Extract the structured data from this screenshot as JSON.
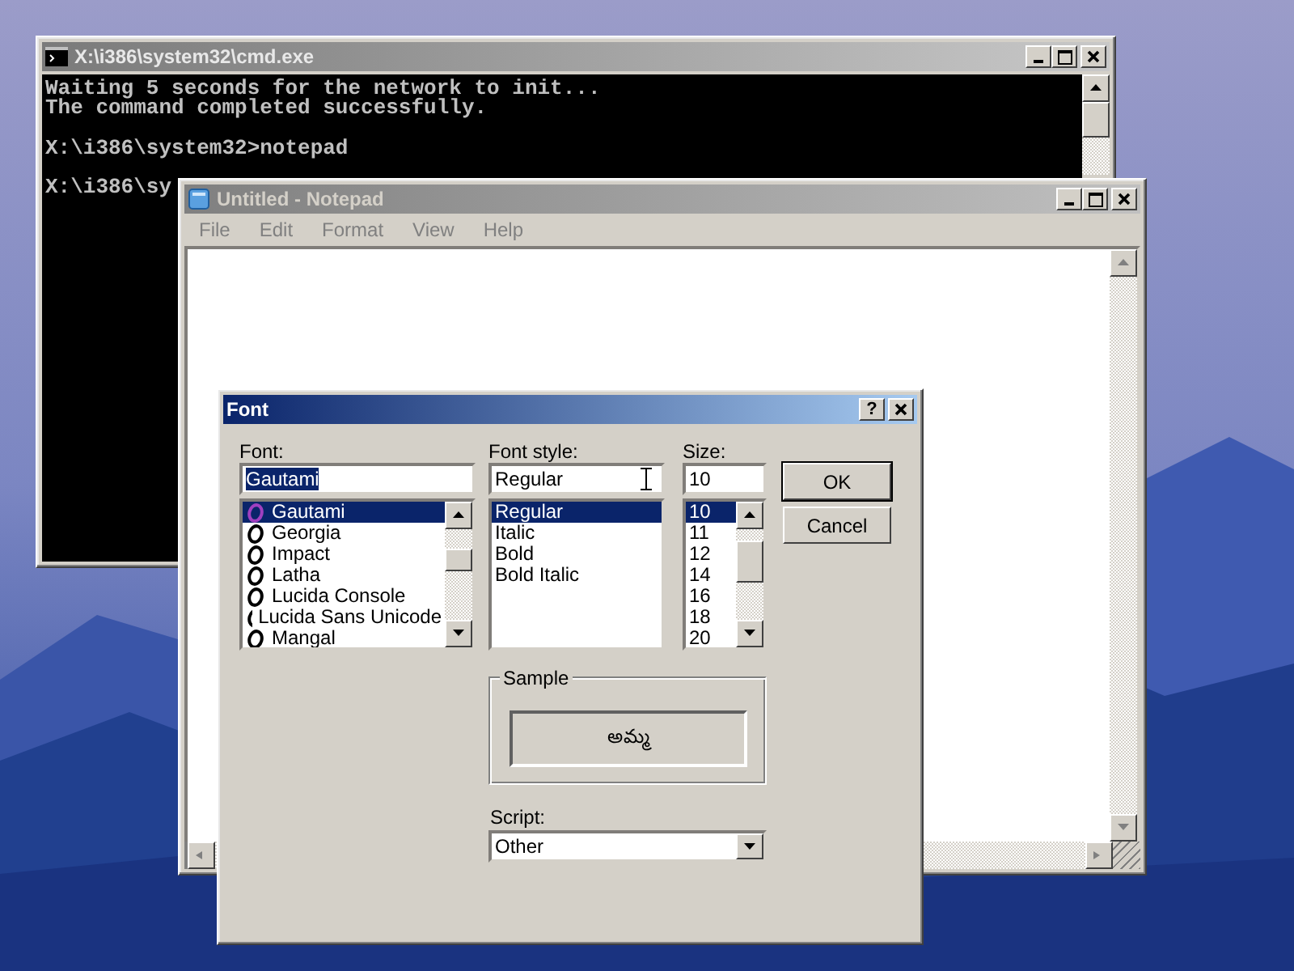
{
  "console_window": {
    "title": "X:\\i386\\system32\\cmd.exe",
    "lines": [
      {
        "text": "Waiting 5 seconds for the network to init...",
        "blank_before": false
      },
      {
        "text": "The command completed successfully.",
        "blank_before": false
      },
      {
        "text": "X:\\i386\\system32>notepad",
        "blank_before": true
      },
      {
        "text": "X:\\i386\\sy",
        "blank_before": true
      }
    ]
  },
  "notepad_window": {
    "title": "Untitled - Notepad",
    "menu": [
      "File",
      "Edit",
      "Format",
      "View",
      "Help"
    ]
  },
  "font_dialog": {
    "title": "Font",
    "help_button": "?",
    "font": {
      "label": "Font:",
      "value": "Gautami",
      "items": [
        {
          "name": "Gautami",
          "selected": true
        },
        {
          "name": "Georgia",
          "selected": false
        },
        {
          "name": "Impact",
          "selected": false
        },
        {
          "name": "Latha",
          "selected": false
        },
        {
          "name": "Lucida Console",
          "selected": false
        },
        {
          "name": "Lucida Sans Unicode",
          "selected": false
        },
        {
          "name": "Mangal",
          "selected": false
        }
      ]
    },
    "style": {
      "label": "Font style:",
      "value": "Regular",
      "items": [
        {
          "name": "Regular",
          "selected": true
        },
        {
          "name": "Italic",
          "selected": false
        },
        {
          "name": "Bold",
          "selected": false
        },
        {
          "name": "Bold Italic",
          "selected": false
        }
      ]
    },
    "size": {
      "label": "Size:",
      "value": "10",
      "items": [
        {
          "name": "10",
          "selected": true
        },
        {
          "name": "11",
          "selected": false
        },
        {
          "name": "12",
          "selected": false
        },
        {
          "name": "14",
          "selected": false
        },
        {
          "name": "16",
          "selected": false
        },
        {
          "name": "18",
          "selected": false
        },
        {
          "name": "20",
          "selected": false
        }
      ]
    },
    "buttons": [
      "OK",
      "Cancel"
    ],
    "sample": {
      "label": "Sample",
      "text": "అమ్మ"
    },
    "script": {
      "label": "Script:",
      "value": "Other"
    }
  }
}
